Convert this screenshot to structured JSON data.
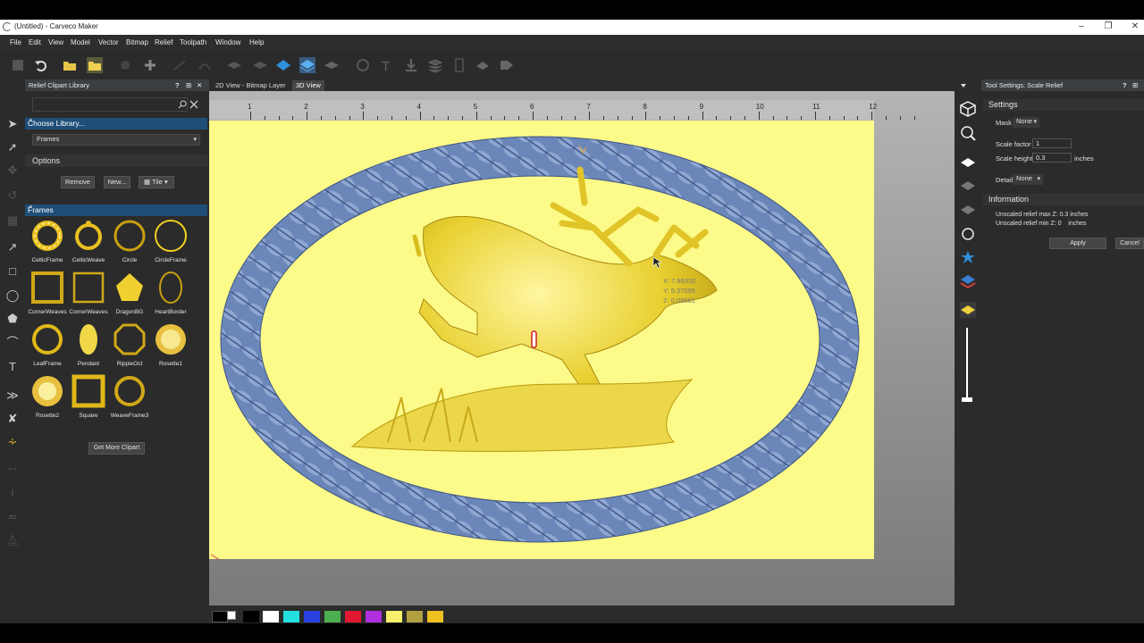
{
  "window": {
    "title": "(Untitled) - Carveco Maker"
  },
  "menu": [
    "File",
    "Edit",
    "View",
    "Model",
    "Vector",
    "Bitmap",
    "Relief",
    "Toolpath",
    "Window",
    "Help"
  ],
  "clipart_panel": {
    "title": "Relief Clipart Library",
    "search_placeholder": "",
    "choose_library_label": "Choose Library...",
    "library_selected": "Frames",
    "options_label": "Options",
    "remove_label": "Remove",
    "new_label": "New...",
    "view_mode": "Tile",
    "frames_label": "Frames",
    "items": [
      "CelticFrame",
      "CelticWeave",
      "Circle",
      "CircleFrame",
      "CornerWeaves",
      "CornerWeaves",
      "DragonBG",
      "HeartBorder",
      "LeafFrame",
      "Pendant",
      "RippleOct",
      "Rosette1",
      "Rosette2",
      "Square",
      "WeaveFrame3"
    ],
    "get_more_label": "Get More Clipart"
  },
  "tabs": [
    "2D View - Bitmap Layer",
    "3D View"
  ],
  "ruler": {
    "ticks": [
      "1",
      "2",
      "3",
      "4",
      "5",
      "6",
      "7",
      "8",
      "9",
      "10",
      "11",
      "12"
    ]
  },
  "cursor_readout": {
    "x": "X: 7.96332",
    "y": "Y: 5.37095",
    "z": "Z: 0.09661"
  },
  "palette": {
    "colors": [
      "#ffffff",
      "#22e0e0",
      "#2a3fe0",
      "#4caf50",
      "#e01830",
      "#b030e0",
      "#f8f06a",
      "#b0a040",
      "#f0c020"
    ]
  },
  "tool_settings": {
    "title": "Tool Settings: Scale Relief",
    "settings_label": "Settings",
    "mask_label": "Mask",
    "mask_value": "None",
    "scale_factor_label": "Scale factor",
    "scale_factor_value": "1",
    "scale_height_label": "Scale height",
    "scale_height_value": "0.3",
    "scale_height_unit": "inches",
    "detail_label": "Detail",
    "detail_value": "None",
    "information_label": "Information",
    "info_max": "Unscaled relief max Z: 0.3 inches",
    "info_min": "Unscaled relief min Z: 0    inches",
    "apply_label": "Apply",
    "cancel_label": "Cancel"
  }
}
